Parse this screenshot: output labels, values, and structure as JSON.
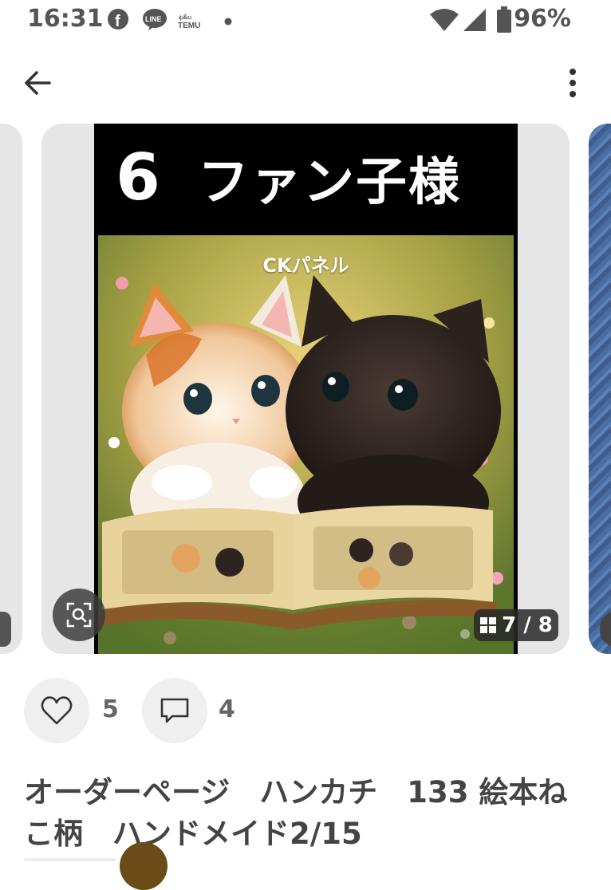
{
  "status_bar": {
    "time": "16:31",
    "notification_icons": [
      "facebook-icon",
      "line-icon",
      "temu-icon",
      "dot-icon"
    ],
    "line_label": "LINE",
    "temu_label": "TEMU",
    "battery": "96%"
  },
  "header": {
    "back_icon": "arrow-left-icon",
    "more_icon": "more-vertical-icon"
  },
  "gallery": {
    "banner_number": "6",
    "banner_text": "ファン子様",
    "art_caption": "CKパネル",
    "counter": "7 / 8"
  },
  "actions": {
    "likes": "5",
    "comments": "4"
  },
  "item": {
    "title": "オーダーページ　ハンカチ　133 絵本ねこ柄　ハンドメイド2/15"
  },
  "colors": {
    "card_bg": "#e6e6e6",
    "overlay": "#333333",
    "icon_gray": "#555555"
  }
}
